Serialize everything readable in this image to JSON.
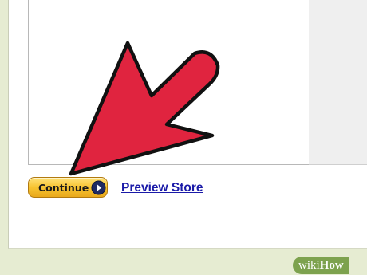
{
  "page": {
    "continue_button": {
      "label": "Continue",
      "icon": "play-circle-icon"
    },
    "preview_link": "Preview Store"
  },
  "overlay": {
    "arrow": {
      "icon": "arrow-pointer-icon",
      "color": "#e0243f"
    },
    "watermark": "wikiHow"
  },
  "colors": {
    "button_gold": "#f7c330",
    "link_blue": "#1a1aa8",
    "background": "#e6ecd2"
  }
}
